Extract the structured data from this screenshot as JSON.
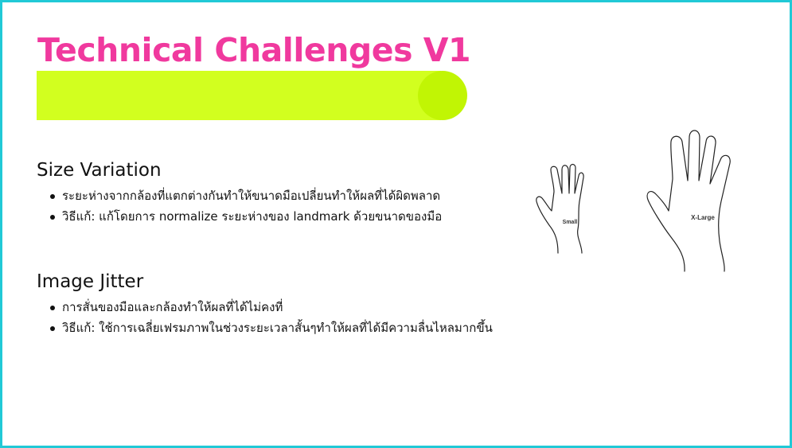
{
  "slide": {
    "title": "Technical Challenges V1",
    "colors": {
      "title": "#f0399e",
      "accent_bar": "#d2ff1f",
      "accent_circle": "#c1f504",
      "frame_border": "#21c9d6"
    }
  },
  "sections": [
    {
      "heading": "Size Variation",
      "bullets": [
        "ระยะห่างจากกล้องที่แตกต่างกันทำให้ขนาดมือเปลี่ยนทำให้ผลที่ได้ผิดพลาด",
        "วิธีแก้: แก้โดยการ normalize ระยะห่างของ landmark ด้วยขนาดของมือ"
      ]
    },
    {
      "heading": "Image Jitter",
      "bullets": [
        "การสั่นของมือและกล้องทำให้ผลที่ได้ไม่คงที่",
        "วิธีแก้: ใช้การเฉลี่ยเฟรมภาพในช่วงระยะเวลาสั้นๆทำให้ผลที่ได้มีความลื่นไหลมากขึ้น"
      ]
    }
  ],
  "figure": {
    "small_label": "Small",
    "large_label": "X-Large"
  }
}
